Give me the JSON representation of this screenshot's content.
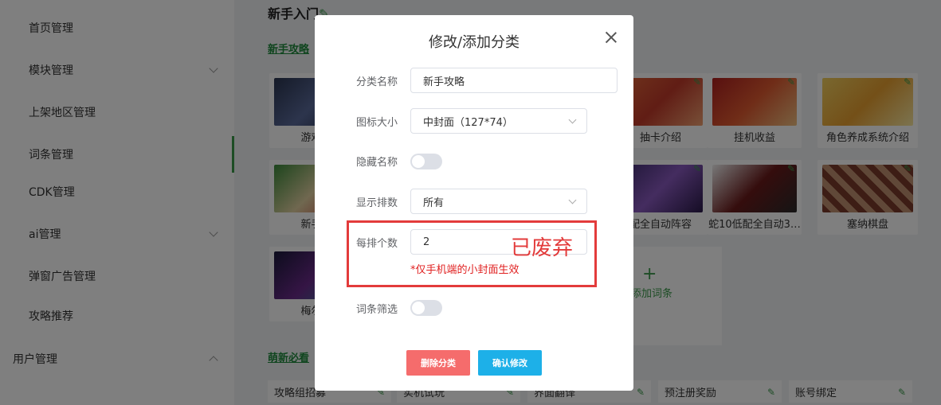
{
  "sidebar": {
    "items": [
      {
        "label": "首页管理"
      },
      {
        "label": "模块管理"
      },
      {
        "label": "上架地区管理"
      },
      {
        "label": "词条管理"
      },
      {
        "label": "CDK管理"
      },
      {
        "label": "ai管理"
      },
      {
        "label": "弹窗广告管理"
      },
      {
        "label": "攻略推荐"
      },
      {
        "label": "用户管理"
      }
    ]
  },
  "main": {
    "page_title": "新手入门",
    "section1_title": "新手攻略",
    "section2_title": "萌新必看",
    "cards": [
      {
        "label": "游戏安"
      },
      {
        "label": "抽卡介绍"
      },
      {
        "label": "挂机收益"
      },
      {
        "label": "角色养成系统介绍"
      },
      {
        "label": "新手入"
      },
      {
        "label": "配全自动阵容"
      },
      {
        "label": "蛇10低配全自动3…"
      },
      {
        "label": "塞纳棋盘"
      },
      {
        "label": "梅尔基"
      }
    ],
    "add_card_label": "添加词条",
    "chips": [
      {
        "label": "攻略组招募"
      },
      {
        "label": "实机试玩"
      },
      {
        "label": "界面翻译"
      },
      {
        "label": "预注册奖励"
      },
      {
        "label": "账号绑定"
      }
    ],
    "accent_color": "#1f8a3c"
  },
  "dialog": {
    "title": "修改/添加分类",
    "fields": {
      "name_label": "分类名称",
      "name_value": "新手攻略",
      "icon_size_label": "图标大小",
      "icon_size_value": "中封面（127*74）",
      "hide_name_label": "隐藏名称",
      "display_rows_label": "显示排数",
      "display_rows_value": "所有",
      "per_row_label": "每排个数",
      "per_row_value": "2",
      "per_row_hint": "*仅手机端的小封面生效",
      "filter_label": "词条筛选"
    },
    "annotation": "已废弃",
    "buttons": {
      "delete": "删除分类",
      "confirm": "确认修改"
    },
    "toggles": {
      "hide_name": false,
      "filter": false
    }
  }
}
